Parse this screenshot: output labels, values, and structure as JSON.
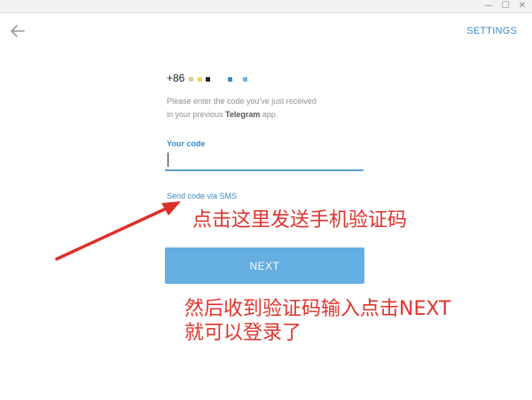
{
  "window": {
    "minimize_glyph": "—",
    "maximize_glyph": "☐",
    "close_glyph": "✕"
  },
  "header": {
    "back_icon": "arrow-left-icon",
    "settings_label": "SETTINGS"
  },
  "login": {
    "phone_prefix": "+86",
    "hint_line1": "Please enter the code you've just received",
    "hint_line2_prefix": "in your previous ",
    "hint_app_name": "Telegram",
    "hint_line2_suffix": " app.",
    "code_label": "Your code",
    "code_value": "",
    "send_sms_label": "Send code via SMS",
    "next_label": "NEXT"
  },
  "annotations": {
    "arrow_text": "点击这里发送手机验证码",
    "bottom_line1": "然后收到验证码输入点击NEXT",
    "bottom_line2": "就可以登录了"
  },
  "colors": {
    "accent": "#3a8ac8",
    "button": "#64aee2",
    "annotation": "#e0332c"
  }
}
